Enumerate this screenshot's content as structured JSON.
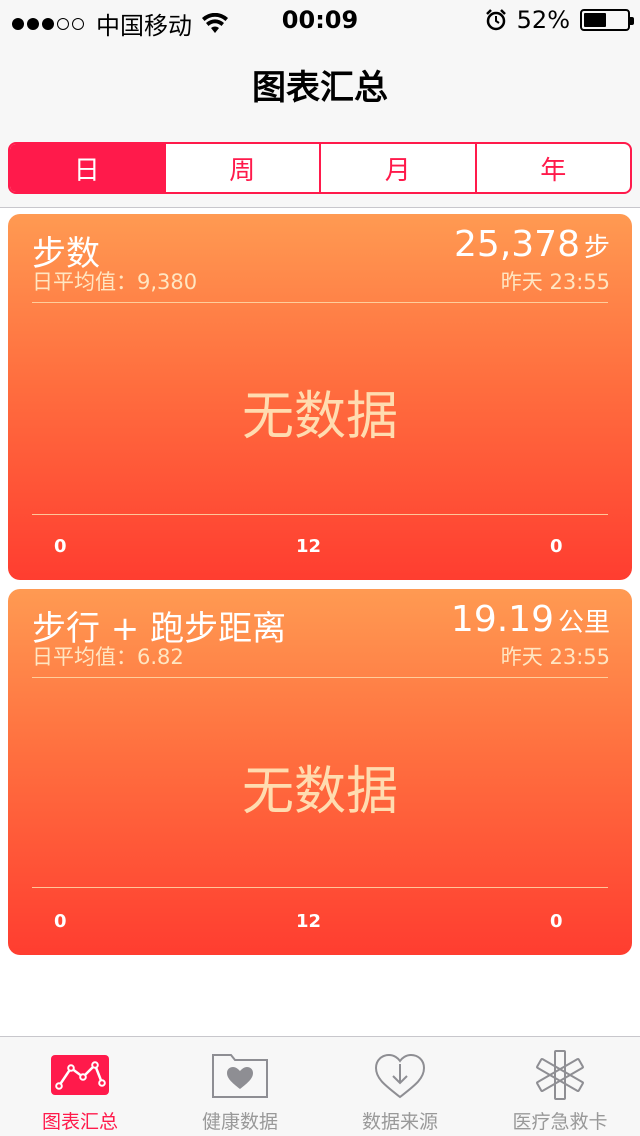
{
  "status_bar": {
    "carrier": "中国移动",
    "time": "00:09",
    "battery_percent": "52%",
    "battery_level": 0.52
  },
  "nav": {
    "title": "图表汇总"
  },
  "segments": [
    {
      "label": "日",
      "active": true
    },
    {
      "label": "周",
      "active": false
    },
    {
      "label": "月",
      "active": false
    },
    {
      "label": "年",
      "active": false
    }
  ],
  "cards": [
    {
      "title": "步数",
      "value": "25,378",
      "unit": "步",
      "avg_label": "日平均值：9,380",
      "time_label": "昨天 23:55",
      "no_data": "无数据",
      "axis": [
        "0",
        "12",
        "0"
      ]
    },
    {
      "title": "步行 + 跑步距离",
      "value": "19.19",
      "unit": "公里",
      "avg_label": "日平均值：6.82",
      "time_label": "昨天 23:55",
      "no_data": "无数据",
      "axis": [
        "0",
        "12",
        "0"
      ]
    }
  ],
  "tab_bar": {
    "items": [
      {
        "label": "图表汇总",
        "icon": "chart-icon",
        "active": true
      },
      {
        "label": "健康数据",
        "icon": "health-data-folder-icon",
        "active": false
      },
      {
        "label": "数据来源",
        "icon": "data-sources-icon",
        "active": false
      },
      {
        "label": "医疗急救卡",
        "icon": "medical-id-icon",
        "active": false
      }
    ]
  },
  "colors": {
    "accent": "#ff1a4b",
    "card_top": "#ff9a52",
    "card_bottom": "#ff3d30"
  }
}
